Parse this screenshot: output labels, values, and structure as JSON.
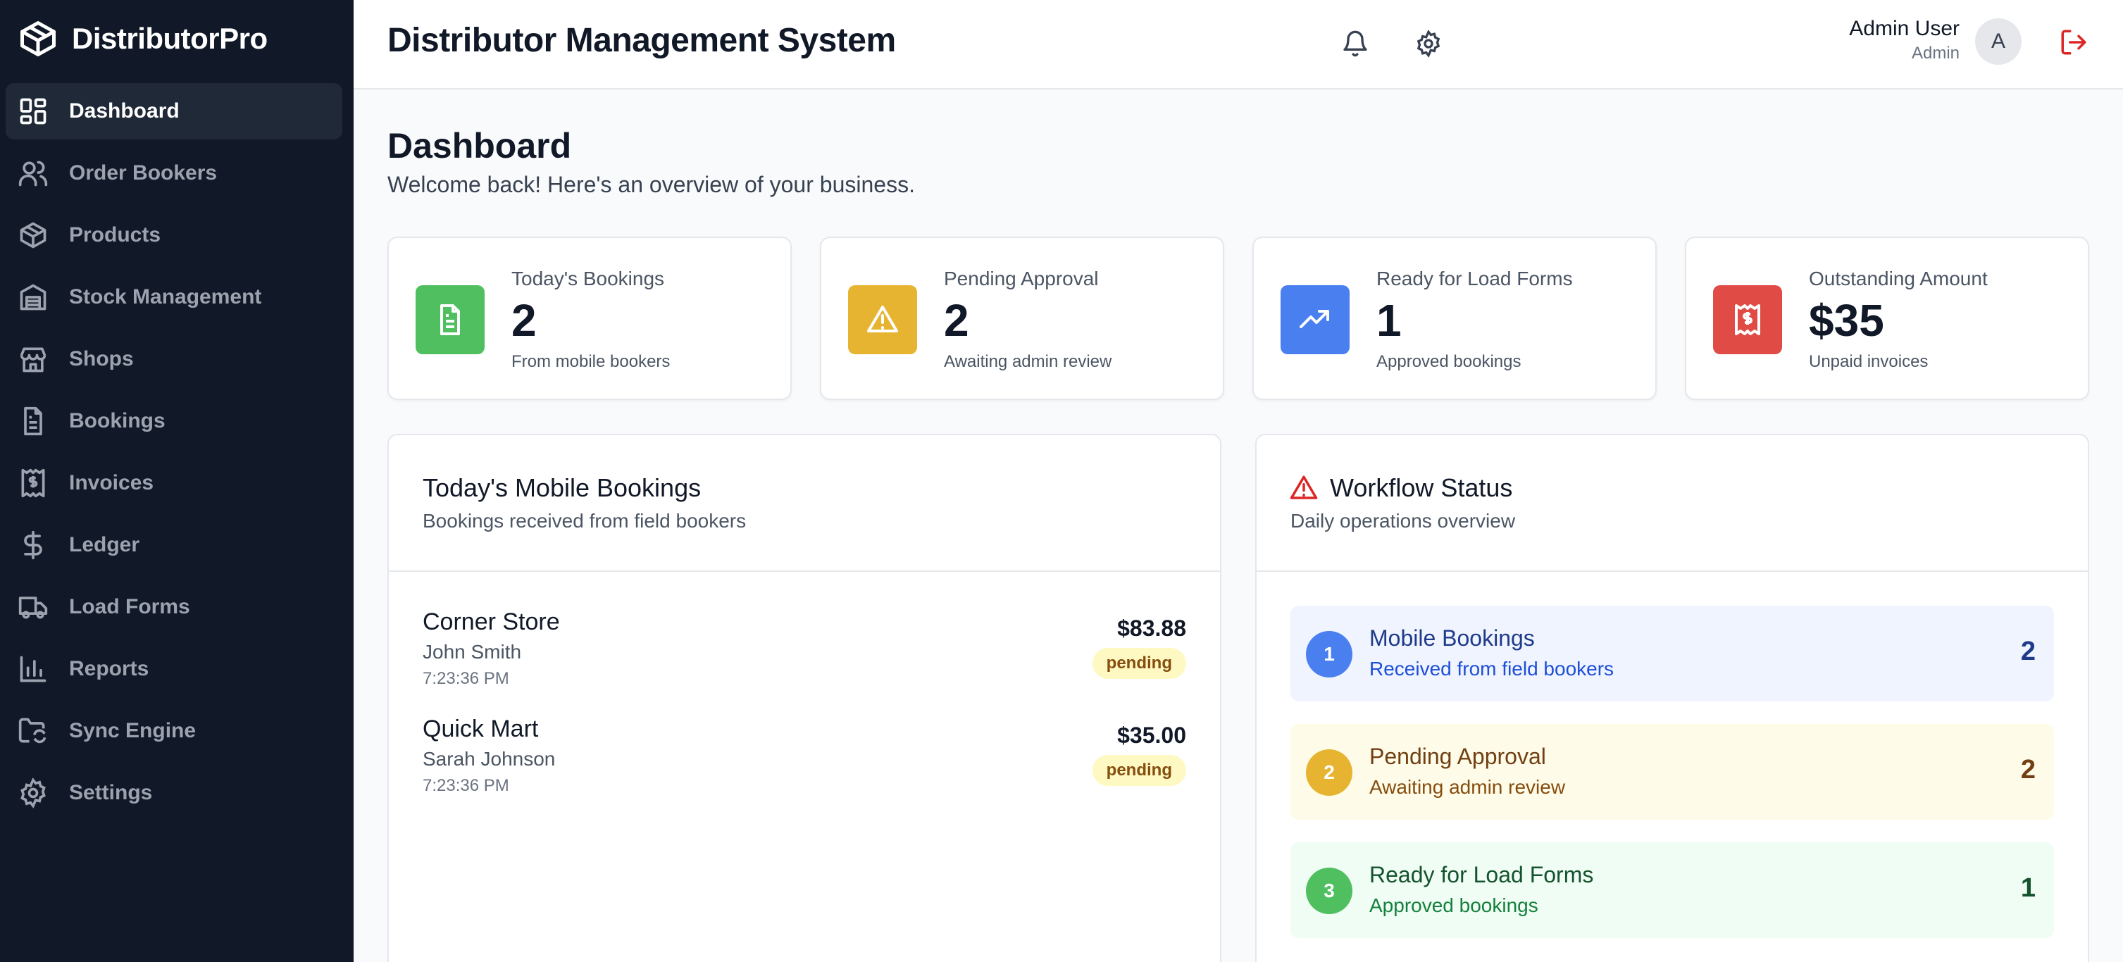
{
  "brand": {
    "name": "DistributorPro"
  },
  "sidebar": {
    "items": [
      {
        "label": "Dashboard",
        "icon": "dashboard-icon",
        "active": true
      },
      {
        "label": "Order Bookers",
        "icon": "users-icon"
      },
      {
        "label": "Products",
        "icon": "package-icon"
      },
      {
        "label": "Stock Management",
        "icon": "warehouse-icon"
      },
      {
        "label": "Shops",
        "icon": "store-icon"
      },
      {
        "label": "Bookings",
        "icon": "file-text-icon"
      },
      {
        "label": "Invoices",
        "icon": "receipt-icon"
      },
      {
        "label": "Ledger",
        "icon": "dollar-icon"
      },
      {
        "label": "Load Forms",
        "icon": "truck-icon"
      },
      {
        "label": "Reports",
        "icon": "bar-chart-icon"
      },
      {
        "label": "Sync Engine",
        "icon": "folder-sync-icon"
      },
      {
        "label": "Settings",
        "icon": "gear-icon"
      }
    ]
  },
  "header": {
    "title": "Distributor Management System",
    "user_name": "Admin User",
    "user_role": "Admin",
    "avatar_initial": "A"
  },
  "page": {
    "title": "Dashboard",
    "subtitle": "Welcome back! Here's an overview of your business."
  },
  "stats": [
    {
      "label": "Today's Bookings",
      "value": "2",
      "note": "From mobile bookers",
      "color": "#4fbf5f",
      "icon": "file-text-icon"
    },
    {
      "label": "Pending Approval",
      "value": "2",
      "note": "Awaiting admin review",
      "color": "#e6b430",
      "icon": "alert-triangle-icon"
    },
    {
      "label": "Ready for Load Forms",
      "value": "1",
      "note": "Approved bookings",
      "color": "#4a7ff0",
      "icon": "trending-up-icon"
    },
    {
      "label": "Outstanding Amount",
      "value": "$35",
      "note": "Unpaid invoices",
      "color": "#e04b45",
      "icon": "receipt-icon"
    }
  ],
  "mobile_bookings": {
    "title": "Today's Mobile Bookings",
    "subtitle": "Bookings received from field bookers",
    "items": [
      {
        "shop": "Corner Store",
        "booker": "John Smith",
        "time": "7:23:36 PM",
        "amount": "$83.88",
        "status": "pending"
      },
      {
        "shop": "Quick Mart",
        "booker": "Sarah Johnson",
        "time": "7:23:36 PM",
        "amount": "$35.00",
        "status": "pending"
      }
    ]
  },
  "workflow": {
    "title": "Workflow Status",
    "subtitle": "Daily operations overview",
    "steps": [
      {
        "num": "1",
        "title": "Mobile Bookings",
        "sub": "Received from field bookers",
        "count": "2",
        "bg": "#eff4ff",
        "dot": "#4a7ff0",
        "text": "#1e3a8a",
        "subtext": "#1d4ed8"
      },
      {
        "num": "2",
        "title": "Pending Approval",
        "sub": "Awaiting admin review",
        "count": "2",
        "bg": "#fefbe8",
        "dot": "#e6b430",
        "text": "#713f12",
        "subtext": "#854d0e"
      },
      {
        "num": "3",
        "title": "Ready for Load Forms",
        "sub": "Approved bookings",
        "count": "1",
        "bg": "#f0fdf4",
        "dot": "#4fbf5f",
        "text": "#14532d",
        "subtext": "#15803d"
      }
    ]
  }
}
